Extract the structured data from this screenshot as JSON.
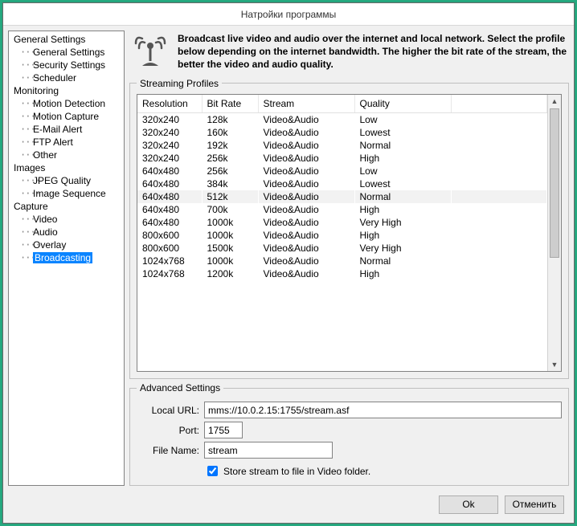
{
  "window": {
    "title": "Натройки программы"
  },
  "sidebar": {
    "groups": [
      {
        "label": "General Settings",
        "children": [
          {
            "label": "General Settings",
            "selected": false
          },
          {
            "label": "Security Settings",
            "selected": false
          },
          {
            "label": "Scheduler",
            "selected": false
          }
        ]
      },
      {
        "label": "Monitoring",
        "children": [
          {
            "label": "Motion Detection",
            "selected": false
          },
          {
            "label": "Motion Capture",
            "selected": false
          },
          {
            "label": "E-Mail Alert",
            "selected": false
          },
          {
            "label": "FTP Alert",
            "selected": false
          },
          {
            "label": "Other",
            "selected": false
          }
        ]
      },
      {
        "label": "Images",
        "children": [
          {
            "label": "JPEG Quality",
            "selected": false
          },
          {
            "label": "Image Sequence",
            "selected": false
          }
        ]
      },
      {
        "label": "Capture",
        "children": [
          {
            "label": "Video",
            "selected": false
          },
          {
            "label": "Audio",
            "selected": false
          },
          {
            "label": "Overlay",
            "selected": false
          },
          {
            "label": "Broadcasting",
            "selected": true
          }
        ]
      }
    ]
  },
  "banner": {
    "text": "Broadcast live video and audio over the internet and local network. Select the profile below depending on the internet bandwidth. The higher the bit rate of the stream, the better the video and audio quality."
  },
  "profiles": {
    "legend": "Streaming Profiles",
    "columns": [
      "Resolution",
      "Bit Rate",
      "Stream",
      "Quality"
    ],
    "rows": [
      {
        "cells": [
          "320x240",
          "128k",
          "Video&Audio",
          "Low"
        ],
        "selected": false
      },
      {
        "cells": [
          "320x240",
          "160k",
          "Video&Audio",
          "Lowest"
        ],
        "selected": false
      },
      {
        "cells": [
          "320x240",
          "192k",
          "Video&Audio",
          "Normal"
        ],
        "selected": false
      },
      {
        "cells": [
          "320x240",
          "256k",
          "Video&Audio",
          "High"
        ],
        "selected": false
      },
      {
        "cells": [
          "640x480",
          "256k",
          "Video&Audio",
          "Low"
        ],
        "selected": false
      },
      {
        "cells": [
          "640x480",
          "384k",
          "Video&Audio",
          "Lowest"
        ],
        "selected": false
      },
      {
        "cells": [
          "640x480",
          "512k",
          "Video&Audio",
          "Normal"
        ],
        "selected": true
      },
      {
        "cells": [
          "640x480",
          "700k",
          "Video&Audio",
          "High"
        ],
        "selected": false
      },
      {
        "cells": [
          "640x480",
          "1000k",
          "Video&Audio",
          "Very High"
        ],
        "selected": false
      },
      {
        "cells": [
          "800x600",
          "1000k",
          "Video&Audio",
          "High"
        ],
        "selected": false
      },
      {
        "cells": [
          "800x600",
          "1500k",
          "Video&Audio",
          "Very High"
        ],
        "selected": false
      },
      {
        "cells": [
          "1024x768",
          "1000k",
          "Video&Audio",
          "Normal"
        ],
        "selected": false
      },
      {
        "cells": [
          "1024x768",
          "1200k",
          "Video&Audio",
          "High"
        ],
        "selected": false
      }
    ]
  },
  "advanced": {
    "legend": "Advanced Settings",
    "local_url_label": "Local URL:",
    "local_url_value": "mms://10.0.2.15:1755/stream.asf",
    "port_label": "Port:",
    "port_value": "1755",
    "filename_label": "File Name:",
    "filename_value": "stream",
    "store_checked": true,
    "store_label": "Store stream to file in Video folder."
  },
  "footer": {
    "ok": "Ok",
    "cancel": "Отменить"
  }
}
